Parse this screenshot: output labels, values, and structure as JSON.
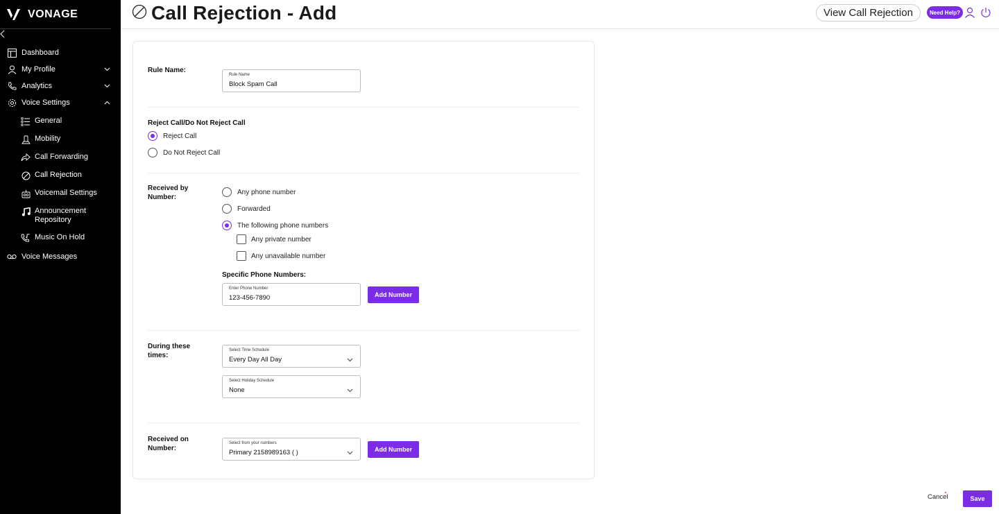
{
  "sidebar": {
    "brand": "VONAGE",
    "collapse_icon": "chevron-left-icon",
    "items": [
      {
        "label": "Dashboard",
        "icon": "dashboard-icon"
      },
      {
        "label": "My Profile",
        "icon": "user-icon"
      },
      {
        "label": "Analytics",
        "icon": "phone-icon"
      },
      {
        "label": "Voice Settings",
        "icon": "gear-icon"
      }
    ],
    "sub_items": [
      {
        "label": "General",
        "icon": "list-icon"
      },
      {
        "label": "Mobility",
        "icon": "mobility-icon"
      },
      {
        "label": "Call Forwarding",
        "icon": "forward-icon"
      },
      {
        "label": "Call Rejection",
        "icon": "block-icon"
      },
      {
        "label": "Voicemail Settings",
        "icon": "voicemail-settings-icon"
      },
      {
        "label": "Announcement Repository",
        "icon": "music-note-icon"
      },
      {
        "label": "Music On Hold",
        "icon": "music-hold-icon"
      }
    ],
    "voice_messages": {
      "label": "Voice Messages",
      "icon": "voicemail-icon"
    }
  },
  "header": {
    "title": "Call Rejection - Add",
    "view_button": "View Call Rejection",
    "help_button": "Need Help?"
  },
  "form": {
    "rule_name": {
      "label": "Rule Name:",
      "field_label": "Rule Name",
      "value": "Block Spam Call"
    },
    "reject": {
      "label": "Reject Call/Do Not Reject Call",
      "options": [
        "Reject Call",
        "Do Not Reject Call"
      ],
      "selected": "Reject Call"
    },
    "received_by": {
      "label_line1": "Received by",
      "label_line2": "Number:",
      "options": [
        "Any phone number",
        "Forwarded",
        "The following phone numbers"
      ],
      "selected": "The following phone numbers",
      "checkboxes": [
        "Any private number",
        "Any unavailable number"
      ],
      "specific_label": "Specific Phone Numbers:",
      "phone_field_label": "Enter Phone Number",
      "phone_value": "123-456-7890",
      "add_button": "Add Number"
    },
    "during": {
      "label_line1": "During these",
      "label_line2": "times:",
      "time_schedule": {
        "field_label": "Select Time Schedule",
        "value": "Every Day All Day"
      },
      "holiday_schedule": {
        "field_label": "Select Holiday Schedule",
        "value": "None"
      }
    },
    "received_on": {
      "label_line1": "Received on",
      "label_line2": "Number:",
      "field_label": "Select from your numbers",
      "value": "Primary 2158989163 ( )",
      "add_button": "Add Number"
    }
  },
  "footer": {
    "cancel": "Cancel",
    "save": "Save"
  },
  "colors": {
    "accent": "#7b2ce6",
    "sidebar_bg": "#000000"
  }
}
